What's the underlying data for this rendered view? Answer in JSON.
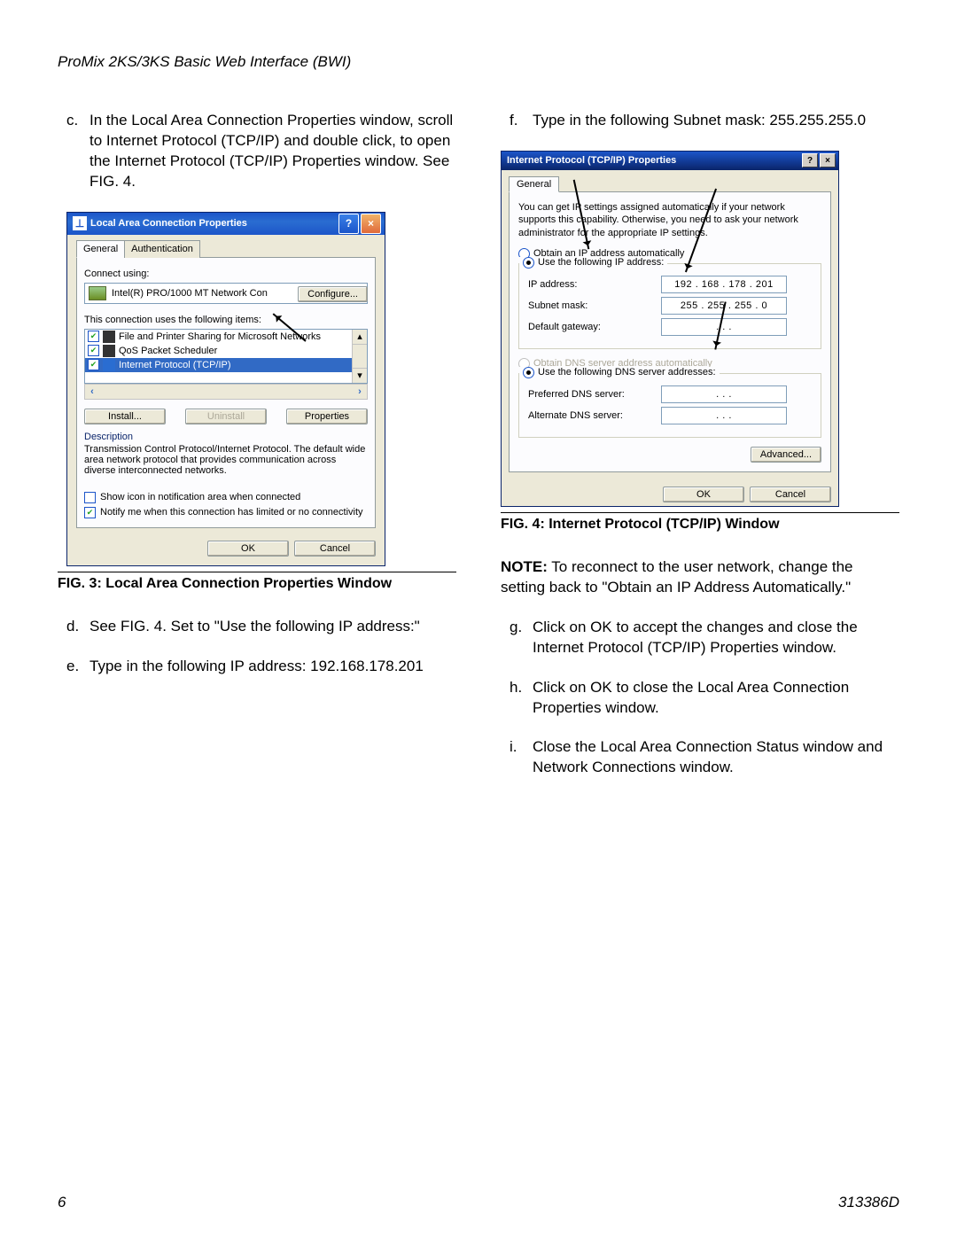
{
  "header": "ProMix 2KS/3KS Basic Web Interface (BWI)",
  "page_number": "6",
  "doc_number": "313386D",
  "left": {
    "step_c": {
      "letter": "c.",
      "text": "In the Local Area Connection Properties window, scroll to Internet Protocol (TCP/IP) and double click, to open the Internet Protocol (TCP/IP) Properties window. See FIG. 4."
    },
    "step_d": {
      "letter": "d.",
      "text": "See FIG. 4. Set to \"Use the following IP address:\""
    },
    "step_e": {
      "letter": "e.",
      "text": "Type in the following IP address: 192.168.178.201"
    },
    "fig3_caption": "FIG. 3: Local Area Connection Properties Window"
  },
  "right": {
    "step_f": {
      "letter": "f.",
      "text": "Type in the following Subnet mask: 255.255.255.0"
    },
    "fig4_caption": "FIG. 4: Internet Protocol (TCP/IP) Window",
    "note_label": "NOTE:",
    "note_text": " To reconnect to the user network, change the setting back to \"Obtain an IP Address Automatically.\"",
    "step_g": {
      "letter": "g.",
      "text": "Click on OK to accept the changes and close the Internet Protocol (TCP/IP) Properties window."
    },
    "step_h": {
      "letter": "h.",
      "text": "Click on OK to close the Local Area Connection Properties window."
    },
    "step_i": {
      "letter": "i.",
      "text": "Close the Local Area Connection Status window and Network Connections window."
    }
  },
  "win1": {
    "title": "Local Area Connection Properties",
    "tabs": {
      "general": "General",
      "auth": "Authentication"
    },
    "connect_using": "Connect using:",
    "adapter": "Intel(R) PRO/1000 MT Network Con",
    "configure": "Configure...",
    "items_label": "This connection uses the following items:",
    "items": [
      "File and Printer Sharing for Microsoft Networks",
      "QoS Packet Scheduler",
      "Internet Protocol (TCP/IP)"
    ],
    "install": "Install...",
    "uninstall": "Uninstall",
    "properties": "Properties",
    "description": "Description",
    "desc_text": "Transmission Control Protocol/Internet Protocol. The default wide area network protocol that provides communication across diverse interconnected networks.",
    "show_icon": "Show icon in notification area when connected",
    "notify": "Notify me when this connection has limited or no connectivity",
    "ok": "OK",
    "cancel": "Cancel"
  },
  "win2": {
    "title": "Internet Protocol (TCP/IP) Properties",
    "tab_general": "General",
    "intro": "You can get IP settings assigned automatically if your network supports this capability. Otherwise, you need to ask your network administrator for the appropriate IP settings.",
    "obtain_ip": "Obtain an IP address automatically",
    "use_ip": "Use the following IP address:",
    "ip_label": "IP address:",
    "ip_value": "192 . 168 . 178 . 201",
    "subnet_label": "Subnet mask:",
    "subnet_value": "255 . 255 . 255 .   0",
    "gateway_label": "Default gateway:",
    "gateway_value": ".          .          .",
    "obtain_dns": "Obtain DNS server address automatically",
    "use_dns": "Use the following DNS server addresses:",
    "pref_dns_label": "Preferred DNS server:",
    "pref_dns_value": ".          .          .",
    "alt_dns_label": "Alternate DNS server:",
    "alt_dns_value": ".          .          .",
    "advanced": "Advanced...",
    "ok": "OK",
    "cancel": "Cancel"
  }
}
